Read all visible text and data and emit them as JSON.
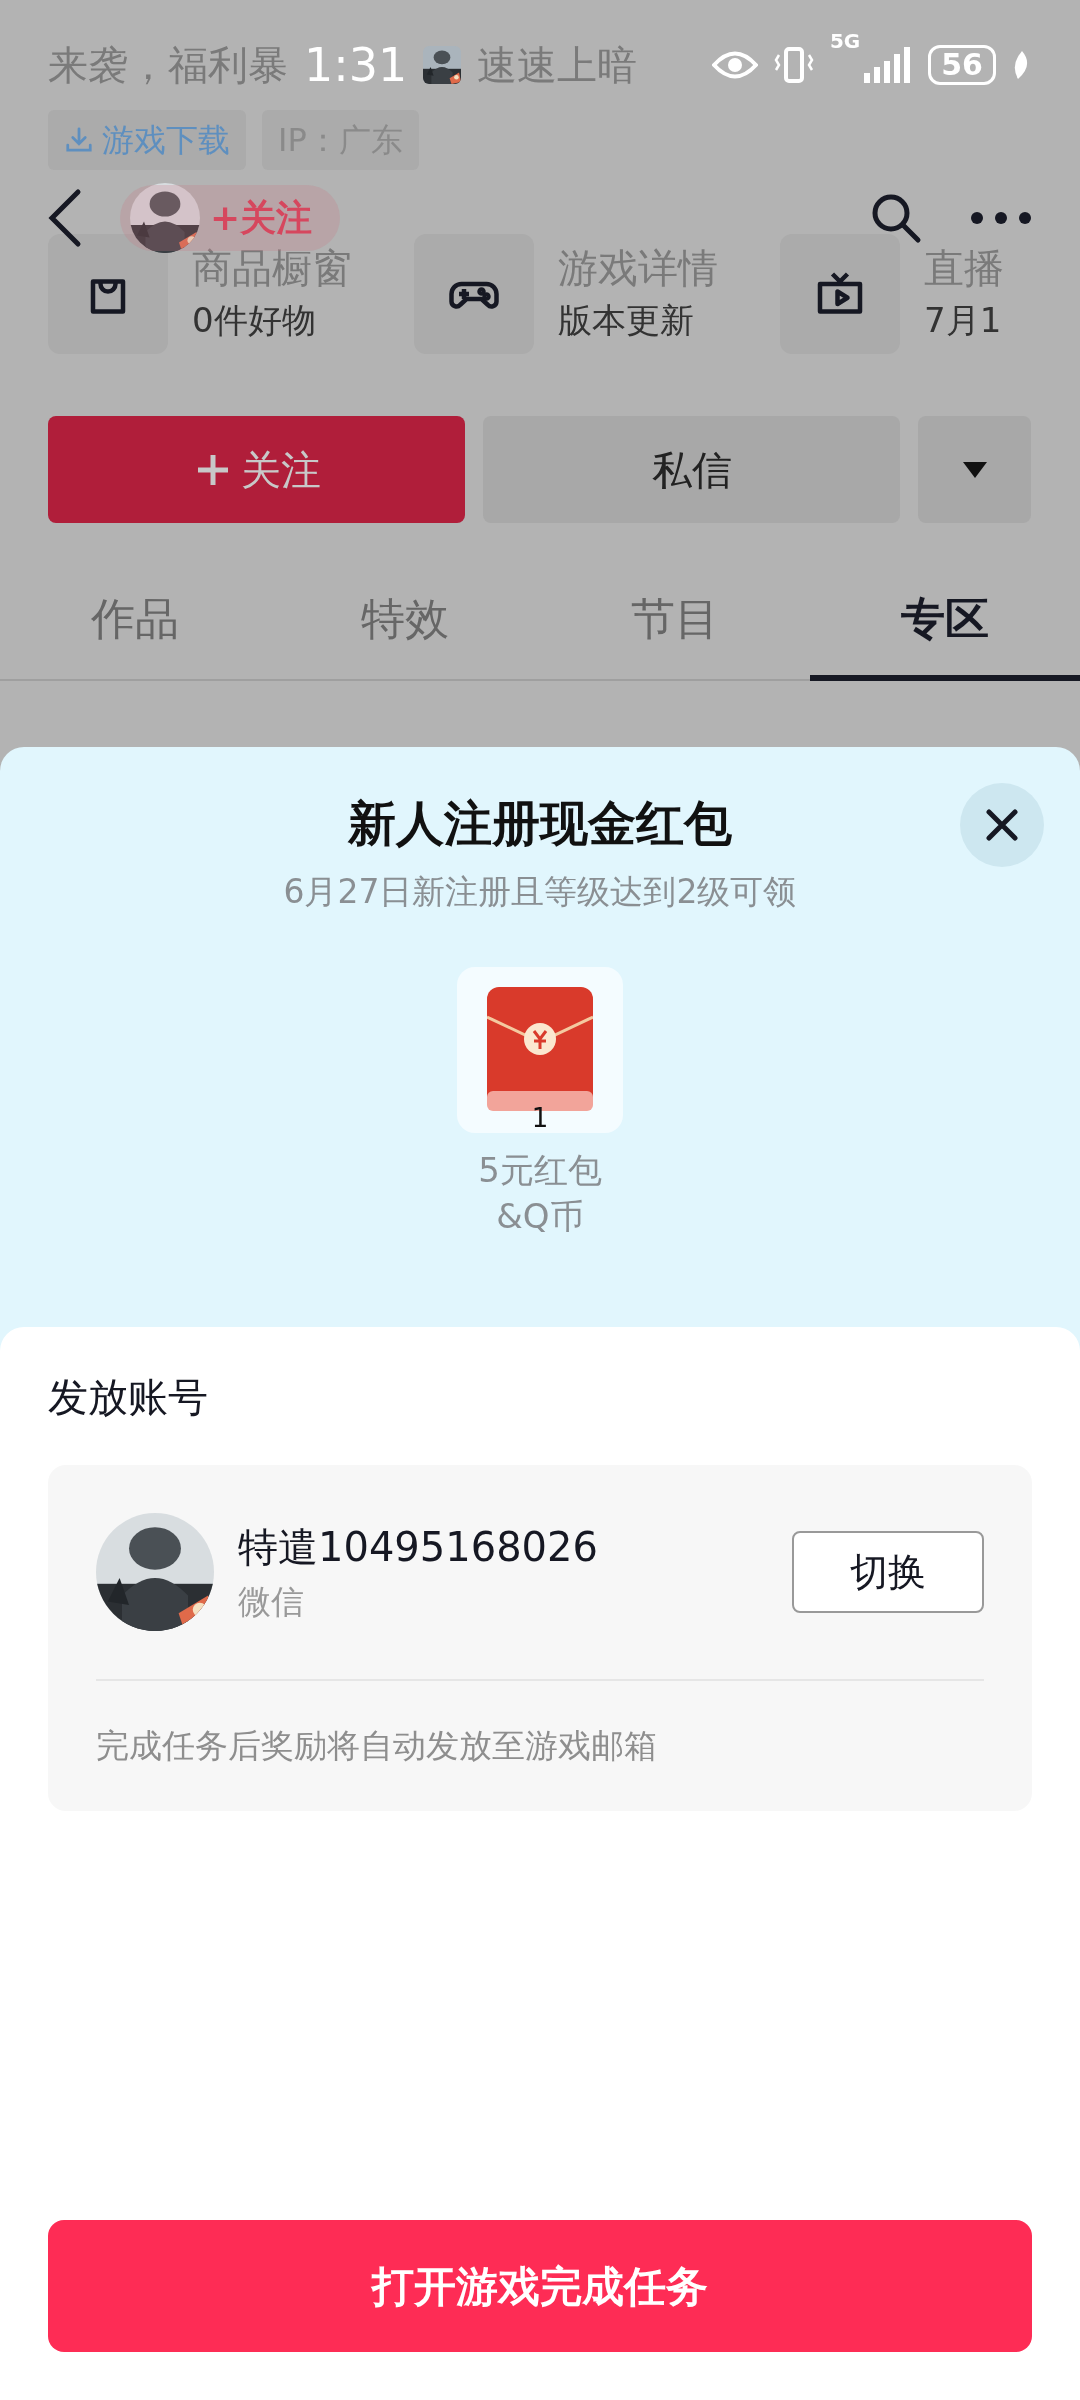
{
  "status_bar": {
    "time": "1:31",
    "network": "5G",
    "battery": "56"
  },
  "post": {
    "description_parts": [
      "来袭，福利暴",
      "速速上暗"
    ],
    "tags": [
      {
        "kind": "download",
        "label": "游戏下载"
      },
      {
        "kind": "plain",
        "label": "IP：广东"
      }
    ]
  },
  "header": {
    "follow_label": "+关注"
  },
  "shortcuts": [
    {
      "kind": "bag",
      "title": "商品橱窗",
      "subtitle": "0件好物"
    },
    {
      "kind": "gamepad",
      "title": "游戏详情",
      "subtitle": "版本更新"
    },
    {
      "kind": "tv",
      "title": "直播",
      "subtitle": "7月1"
    }
  ],
  "actions": {
    "follow": "关注",
    "message": "私信"
  },
  "tabs": [
    {
      "label": "作品",
      "selected": false
    },
    {
      "label": "特效",
      "selected": false
    },
    {
      "label": "节目",
      "selected": false
    },
    {
      "label": "专区",
      "selected": true
    }
  ],
  "sheet": {
    "title": "新人注册现金红包",
    "subtitle": "6月27日新注册且等级达到2级可领",
    "rewards": [
      {
        "count": "1",
        "label": "5元红包\n&Q币"
      }
    ],
    "account": {
      "heading": "发放账号",
      "name": "特遣10495168026",
      "platform": "微信",
      "switch": "切换",
      "note": "完成任务后奖励将自动发放至游戏邮箱"
    },
    "primary_button": "打开游戏完成任务"
  }
}
